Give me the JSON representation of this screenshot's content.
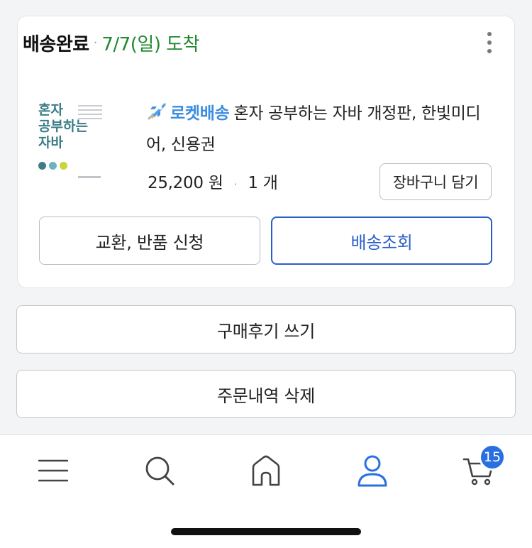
{
  "order": {
    "status": "배송완료",
    "separator": "·",
    "arrival": "7/7(일) 도착",
    "more_icon": "more-vertical-icon"
  },
  "product": {
    "cover_title": "혼자\n공부하는\n자바",
    "badge_icon": "rocket-icon",
    "badge_label": "로켓배송",
    "name": "혼자 공부하는 자바 개정판, 한빛미디어, 신용권",
    "price": "25,200 원",
    "separator": "·",
    "quantity": "1 개",
    "cart_label": "장바구니 담기",
    "accent_color": "#3a8de0"
  },
  "actions": {
    "exchange_label": "교환, 반품 신청",
    "track_label": "배송조회",
    "review_label": "구매후기 쓰기",
    "delete_label": "주문내역 삭제"
  },
  "bottom_nav": {
    "items": [
      {
        "icon": "menu-icon"
      },
      {
        "icon": "search-icon"
      },
      {
        "icon": "home-icon"
      },
      {
        "icon": "user-icon",
        "active": true
      },
      {
        "icon": "cart-icon"
      }
    ],
    "cart_badge": "15",
    "active_color": "#2a6fe0"
  }
}
